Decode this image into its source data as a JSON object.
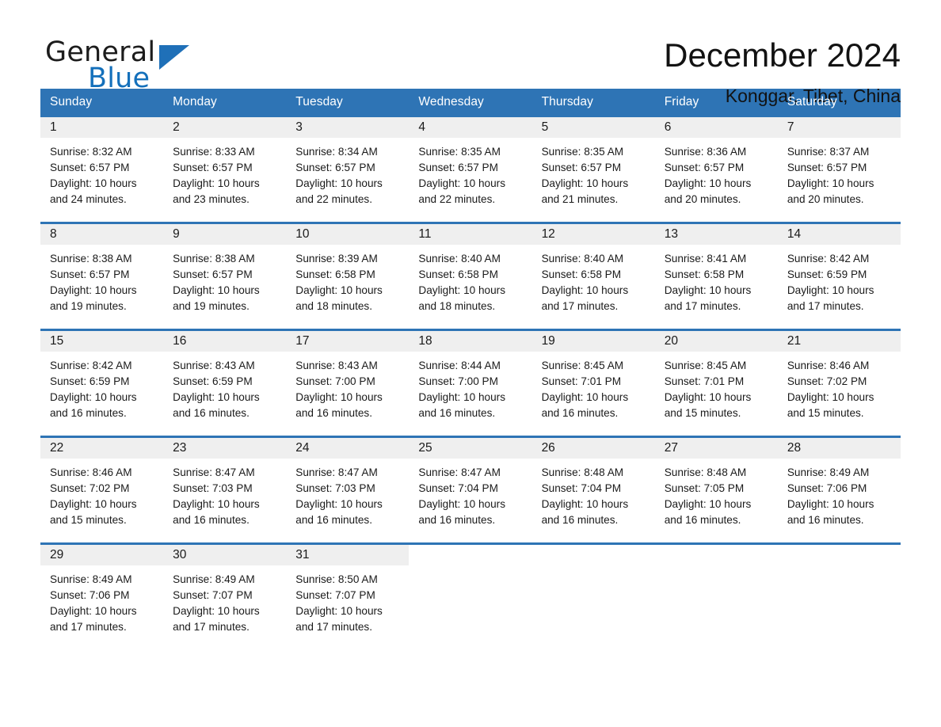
{
  "brand": {
    "name_top": "General",
    "name_bottom": "Blue",
    "triangle_color": "#1f70b8",
    "text_color_top": "#1c1c1c",
    "text_color_bottom": "#1470bb"
  },
  "header": {
    "month_title": "December 2024",
    "location": "Konggar, Tibet, China"
  },
  "theme": {
    "header_blue": "#2e74b5",
    "daynum_band": "#efefef",
    "text": "#1a1a1a"
  },
  "calendar": {
    "weekdays": [
      "Sunday",
      "Monday",
      "Tuesday",
      "Wednesday",
      "Thursday",
      "Friday",
      "Saturday"
    ],
    "weeks": [
      [
        {
          "day": "1",
          "sunrise": "Sunrise: 8:32 AM",
          "sunset": "Sunset: 6:57 PM",
          "daylight_line1": "Daylight: 10 hours",
          "daylight_line2": "and 24 minutes."
        },
        {
          "day": "2",
          "sunrise": "Sunrise: 8:33 AM",
          "sunset": "Sunset: 6:57 PM",
          "daylight_line1": "Daylight: 10 hours",
          "daylight_line2": "and 23 minutes."
        },
        {
          "day": "3",
          "sunrise": "Sunrise: 8:34 AM",
          "sunset": "Sunset: 6:57 PM",
          "daylight_line1": "Daylight: 10 hours",
          "daylight_line2": "and 22 minutes."
        },
        {
          "day": "4",
          "sunrise": "Sunrise: 8:35 AM",
          "sunset": "Sunset: 6:57 PM",
          "daylight_line1": "Daylight: 10 hours",
          "daylight_line2": "and 22 minutes."
        },
        {
          "day": "5",
          "sunrise": "Sunrise: 8:35 AM",
          "sunset": "Sunset: 6:57 PM",
          "daylight_line1": "Daylight: 10 hours",
          "daylight_line2": "and 21 minutes."
        },
        {
          "day": "6",
          "sunrise": "Sunrise: 8:36 AM",
          "sunset": "Sunset: 6:57 PM",
          "daylight_line1": "Daylight: 10 hours",
          "daylight_line2": "and 20 minutes."
        },
        {
          "day": "7",
          "sunrise": "Sunrise: 8:37 AM",
          "sunset": "Sunset: 6:57 PM",
          "daylight_line1": "Daylight: 10 hours",
          "daylight_line2": "and 20 minutes."
        }
      ],
      [
        {
          "day": "8",
          "sunrise": "Sunrise: 8:38 AM",
          "sunset": "Sunset: 6:57 PM",
          "daylight_line1": "Daylight: 10 hours",
          "daylight_line2": "and 19 minutes."
        },
        {
          "day": "9",
          "sunrise": "Sunrise: 8:38 AM",
          "sunset": "Sunset: 6:57 PM",
          "daylight_line1": "Daylight: 10 hours",
          "daylight_line2": "and 19 minutes."
        },
        {
          "day": "10",
          "sunrise": "Sunrise: 8:39 AM",
          "sunset": "Sunset: 6:58 PM",
          "daylight_line1": "Daylight: 10 hours",
          "daylight_line2": "and 18 minutes."
        },
        {
          "day": "11",
          "sunrise": "Sunrise: 8:40 AM",
          "sunset": "Sunset: 6:58 PM",
          "daylight_line1": "Daylight: 10 hours",
          "daylight_line2": "and 18 minutes."
        },
        {
          "day": "12",
          "sunrise": "Sunrise: 8:40 AM",
          "sunset": "Sunset: 6:58 PM",
          "daylight_line1": "Daylight: 10 hours",
          "daylight_line2": "and 17 minutes."
        },
        {
          "day": "13",
          "sunrise": "Sunrise: 8:41 AM",
          "sunset": "Sunset: 6:58 PM",
          "daylight_line1": "Daylight: 10 hours",
          "daylight_line2": "and 17 minutes."
        },
        {
          "day": "14",
          "sunrise": "Sunrise: 8:42 AM",
          "sunset": "Sunset: 6:59 PM",
          "daylight_line1": "Daylight: 10 hours",
          "daylight_line2": "and 17 minutes."
        }
      ],
      [
        {
          "day": "15",
          "sunrise": "Sunrise: 8:42 AM",
          "sunset": "Sunset: 6:59 PM",
          "daylight_line1": "Daylight: 10 hours",
          "daylight_line2": "and 16 minutes."
        },
        {
          "day": "16",
          "sunrise": "Sunrise: 8:43 AM",
          "sunset": "Sunset: 6:59 PM",
          "daylight_line1": "Daylight: 10 hours",
          "daylight_line2": "and 16 minutes."
        },
        {
          "day": "17",
          "sunrise": "Sunrise: 8:43 AM",
          "sunset": "Sunset: 7:00 PM",
          "daylight_line1": "Daylight: 10 hours",
          "daylight_line2": "and 16 minutes."
        },
        {
          "day": "18",
          "sunrise": "Sunrise: 8:44 AM",
          "sunset": "Sunset: 7:00 PM",
          "daylight_line1": "Daylight: 10 hours",
          "daylight_line2": "and 16 minutes."
        },
        {
          "day": "19",
          "sunrise": "Sunrise: 8:45 AM",
          "sunset": "Sunset: 7:01 PM",
          "daylight_line1": "Daylight: 10 hours",
          "daylight_line2": "and 16 minutes."
        },
        {
          "day": "20",
          "sunrise": "Sunrise: 8:45 AM",
          "sunset": "Sunset: 7:01 PM",
          "daylight_line1": "Daylight: 10 hours",
          "daylight_line2": "and 15 minutes."
        },
        {
          "day": "21",
          "sunrise": "Sunrise: 8:46 AM",
          "sunset": "Sunset: 7:02 PM",
          "daylight_line1": "Daylight: 10 hours",
          "daylight_line2": "and 15 minutes."
        }
      ],
      [
        {
          "day": "22",
          "sunrise": "Sunrise: 8:46 AM",
          "sunset": "Sunset: 7:02 PM",
          "daylight_line1": "Daylight: 10 hours",
          "daylight_line2": "and 15 minutes."
        },
        {
          "day": "23",
          "sunrise": "Sunrise: 8:47 AM",
          "sunset": "Sunset: 7:03 PM",
          "daylight_line1": "Daylight: 10 hours",
          "daylight_line2": "and 16 minutes."
        },
        {
          "day": "24",
          "sunrise": "Sunrise: 8:47 AM",
          "sunset": "Sunset: 7:03 PM",
          "daylight_line1": "Daylight: 10 hours",
          "daylight_line2": "and 16 minutes."
        },
        {
          "day": "25",
          "sunrise": "Sunrise: 8:47 AM",
          "sunset": "Sunset: 7:04 PM",
          "daylight_line1": "Daylight: 10 hours",
          "daylight_line2": "and 16 minutes."
        },
        {
          "day": "26",
          "sunrise": "Sunrise: 8:48 AM",
          "sunset": "Sunset: 7:04 PM",
          "daylight_line1": "Daylight: 10 hours",
          "daylight_line2": "and 16 minutes."
        },
        {
          "day": "27",
          "sunrise": "Sunrise: 8:48 AM",
          "sunset": "Sunset: 7:05 PM",
          "daylight_line1": "Daylight: 10 hours",
          "daylight_line2": "and 16 minutes."
        },
        {
          "day": "28",
          "sunrise": "Sunrise: 8:49 AM",
          "sunset": "Sunset: 7:06 PM",
          "daylight_line1": "Daylight: 10 hours",
          "daylight_line2": "and 16 minutes."
        }
      ],
      [
        {
          "day": "29",
          "sunrise": "Sunrise: 8:49 AM",
          "sunset": "Sunset: 7:06 PM",
          "daylight_line1": "Daylight: 10 hours",
          "daylight_line2": "and 17 minutes."
        },
        {
          "day": "30",
          "sunrise": "Sunrise: 8:49 AM",
          "sunset": "Sunset: 7:07 PM",
          "daylight_line1": "Daylight: 10 hours",
          "daylight_line2": "and 17 minutes."
        },
        {
          "day": "31",
          "sunrise": "Sunrise: 8:50 AM",
          "sunset": "Sunset: 7:07 PM",
          "daylight_line1": "Daylight: 10 hours",
          "daylight_line2": "and 17 minutes."
        },
        {
          "day": "",
          "sunrise": "",
          "sunset": "",
          "daylight_line1": "",
          "daylight_line2": ""
        },
        {
          "day": "",
          "sunrise": "",
          "sunset": "",
          "daylight_line1": "",
          "daylight_line2": ""
        },
        {
          "day": "",
          "sunrise": "",
          "sunset": "",
          "daylight_line1": "",
          "daylight_line2": ""
        },
        {
          "day": "",
          "sunrise": "",
          "sunset": "",
          "daylight_line1": "",
          "daylight_line2": ""
        }
      ]
    ]
  }
}
